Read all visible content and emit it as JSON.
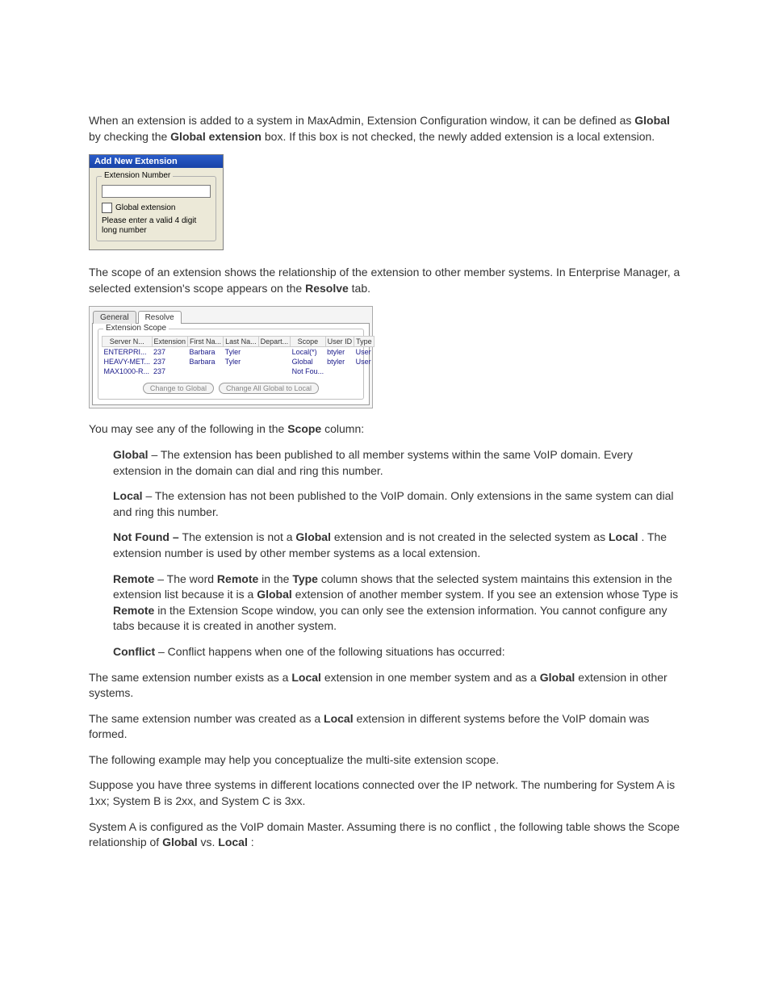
{
  "intro": {
    "p1a": "When an extension is added to a system in MaxAdmin, Extension Configuration window, it can be defined as ",
    "p1b": " by checking the ",
    "p1c": " box. If this box is not checked, the newly added extension is a local extension.",
    "global_label": "Global",
    "global_ext_label": "Global extension"
  },
  "dlg_add": {
    "title": "Add New Extension",
    "legend": "Extension Number",
    "checkbox_label": "Global extension",
    "hint": "Please enter a valid 4 digit long number"
  },
  "intro2": {
    "p2a": "The scope of an extension shows the relationship of the extension to other member systems. In Enterprise Manager, a selected extension's scope appears on the ",
    "p2b": " tab.",
    "resolve_label": "Resolve"
  },
  "scope_panel": {
    "tab_general": "General",
    "tab_resolve": "Resolve",
    "legend": "Extension Scope",
    "headers": [
      "Server N...",
      "Extension",
      "First Na...",
      "Last Na...",
      "Depart...",
      "Scope",
      "User ID",
      "Type"
    ],
    "rows": [
      [
        "ENTERPRI...",
        "237",
        "Barbara",
        "Tyler",
        "",
        "Local(*)",
        "btyler",
        "User"
      ],
      [
        "HEAVY-MET...",
        "237",
        "Barbara",
        "Tyler",
        "",
        "Global",
        "btyler",
        "User"
      ],
      [
        "MAX1000-R...",
        "237",
        "",
        "",
        "",
        "Not Fou...",
        "",
        ""
      ]
    ],
    "btn_change_global": "Change to Global",
    "btn_change_local": "Change All Global to Local"
  },
  "below": {
    "p3a": "You may see any of the following in the ",
    "p3b": " column:",
    "scope_label": "Scope",
    "b_global": "Global",
    "b_global_txt": " – The extension has been published to all member systems within the same VoIP domain. Every extension in the domain can dial and ring this number.",
    "b_local": "Local",
    "b_local_txt": " – The extension has not been published to the VoIP domain. Only extensions in the same system can dial and ring this number.",
    "b_notfound": "Not Found – ",
    "b_notfound_txt1": "The extension is not a ",
    "b_notfound_txt2": " extension and is not created in the selected system as ",
    "b_notfound_txt3": ". The extension number is used by other member systems as a local extension.",
    "b_remote": "Remote",
    "b_remote_txt1": " – The word ",
    "b_remote_txt2": " in the ",
    "b_remote_txt3": " column shows that the selected system maintains this extension in the extension list because it is a ",
    "b_remote_txt4": " extension of another member system. If you see an extension whose Type is ",
    "b_remote_txt5": " in the Extension Scope window, you can only see the extension information. You cannot configure any tabs because it is created in another system.",
    "b_remote_word": "Remote",
    "b_type_word": "Type",
    "b_global_word": "Global",
    "b_local_word": "Local",
    "b_conflict": "Conflict",
    "b_conflict_txt": " – Conflict happens when one of the following situations has occurred:",
    "p4a": "The same extension number exists as a ",
    "p4b": " extension in one member system and as a ",
    "p4c": " extension in other systems.",
    "p5a": "The same extension number was created as a ",
    "p5b": " extension in different systems before the VoIP domain was formed.",
    "p6": "The following example may help you conceptualize the multi-site extension scope.",
    "p7": "Suppose you have three systems in different locations connected over the IP network. The numbering for System A is 1xx; System B is 2xx, and System C is 3xx.",
    "p8a": "System A is configured as the VoIP domain Master. Assuming there is no conflict , the following table shows the Scope relationship of ",
    "p8b": " vs. ",
    "p8c": ":"
  }
}
